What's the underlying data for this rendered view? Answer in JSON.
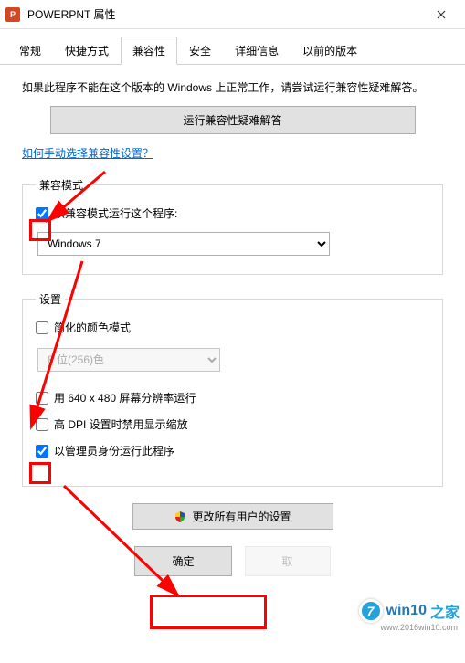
{
  "titlebar": {
    "app_icon_letter": "P",
    "title": "POWERPNT 属性"
  },
  "tabs": {
    "items": [
      {
        "label": "常规"
      },
      {
        "label": "快捷方式"
      },
      {
        "label": "兼容性"
      },
      {
        "label": "安全"
      },
      {
        "label": "详细信息"
      },
      {
        "label": "以前的版本"
      }
    ],
    "active_index": 2
  },
  "body": {
    "description": "如果此程序不能在这个版本的 Windows 上正常工作，请尝试运行兼容性疑难解答。",
    "troubleshoot_button": "运行兼容性疑难解答",
    "manual_link": "如何手动选择兼容性设置？"
  },
  "compat_mode": {
    "legend": "兼容模式",
    "checkbox_label": "以兼容模式运行这个程序:",
    "checked": true,
    "selected_os": "Windows 7"
  },
  "settings": {
    "legend": "设置",
    "reduced_color": {
      "label": "简化的颜色模式",
      "checked": false
    },
    "color_select": {
      "value": "8 位(256)色",
      "disabled": true
    },
    "resolution": {
      "label": "用 640 x 480 屏幕分辨率运行",
      "checked": false
    },
    "dpi": {
      "label": "高 DPI 设置时禁用显示缩放",
      "checked": false
    },
    "admin": {
      "label": "以管理员身份运行此程序",
      "checked": true
    }
  },
  "all_users_button": "更改所有用户的设置",
  "footer": {
    "ok": "确定",
    "cancel": "取"
  },
  "watermark": {
    "brand1": "win10",
    "brand2": "之家",
    "url": "www.2016win10.com"
  }
}
